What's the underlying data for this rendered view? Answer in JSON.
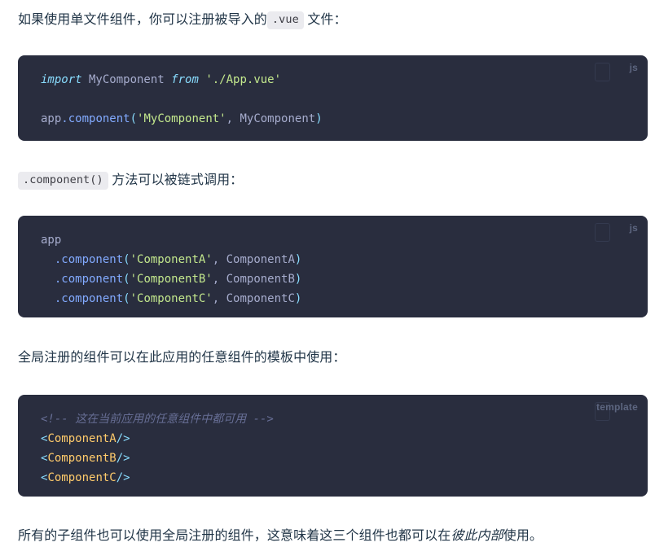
{
  "page": {
    "background": "#ffffff",
    "text_color": "#213547",
    "code_bg": "#292d3e",
    "inline_code_bg": "#ebebef",
    "accent_string": "#c3e88d",
    "accent_keyword": "#89ddff",
    "accent_function": "#82aaff",
    "accent_tag": "#ffcb6b",
    "accent_comment": "#676e95",
    "lang_label_color": "#5d6680"
  },
  "paragraphs": {
    "p1": {
      "before": "如果使用单文件组件，你可以注册被导入的",
      "code": ".vue",
      "after": "文件："
    },
    "p2": {
      "code": ".component()",
      "after": "方法可以被链式调用："
    },
    "p3": {
      "text": "全局注册的组件可以在此应用的任意组件的模板中使用："
    },
    "p4": {
      "before": "所有的子组件也可以使用全局注册的组件，这意味着这三个组件也都可以在",
      "emphasis": "彼此内部",
      "after": "使用。"
    }
  },
  "code_blocks": [
    {
      "lang_label": "js",
      "copy_label": "copy-code",
      "lines": [
        {
          "tokens": [
            {
              "text": "import",
              "type": "keyword"
            },
            {
              "text": " MyComponent ",
              "type": "variable"
            },
            {
              "text": "from",
              "type": "keyword"
            },
            {
              "text": " ",
              "type": "variable"
            },
            {
              "text": "'./App.vue'",
              "type": "string"
            }
          ]
        },
        {
          "tokens": []
        },
        {
          "tokens": [
            {
              "text": "app",
              "type": "variable"
            },
            {
              "text": ".component",
              "type": "function"
            },
            {
              "text": "(",
              "type": "punct"
            },
            {
              "text": "'MyComponent'",
              "type": "string"
            },
            {
              "text": ", ",
              "type": "variable"
            },
            {
              "text": "MyComponent",
              "type": "variable"
            },
            {
              "text": ")",
              "type": "punct"
            }
          ]
        }
      ]
    },
    {
      "lang_label": "js",
      "copy_label": "copy-code",
      "lines": [
        {
          "tokens": [
            {
              "text": "app",
              "type": "variable"
            }
          ]
        },
        {
          "tokens": [
            {
              "text": "  ",
              "type": "variable"
            },
            {
              "text": ".component",
              "type": "function"
            },
            {
              "text": "(",
              "type": "punct"
            },
            {
              "text": "'ComponentA'",
              "type": "string"
            },
            {
              "text": ", ",
              "type": "variable"
            },
            {
              "text": "ComponentA",
              "type": "variable"
            },
            {
              "text": ")",
              "type": "punct"
            }
          ]
        },
        {
          "tokens": [
            {
              "text": "  ",
              "type": "variable"
            },
            {
              "text": ".component",
              "type": "function"
            },
            {
              "text": "(",
              "type": "punct"
            },
            {
              "text": "'ComponentB'",
              "type": "string"
            },
            {
              "text": ", ",
              "type": "variable"
            },
            {
              "text": "ComponentB",
              "type": "variable"
            },
            {
              "text": ")",
              "type": "punct"
            }
          ]
        },
        {
          "tokens": [
            {
              "text": "  ",
              "type": "variable"
            },
            {
              "text": ".component",
              "type": "function"
            },
            {
              "text": "(",
              "type": "punct"
            },
            {
              "text": "'ComponentC'",
              "type": "string"
            },
            {
              "text": ", ",
              "type": "variable"
            },
            {
              "text": "ComponentC",
              "type": "variable"
            },
            {
              "text": ")",
              "type": "punct"
            }
          ]
        }
      ]
    },
    {
      "lang_label": "template",
      "copy_label": "copy-code",
      "lines": [
        {
          "tokens": [
            {
              "text": "<!-- 这在当前应用的任意组件中都可用 -->",
              "type": "comment"
            }
          ]
        },
        {
          "tokens": [
            {
              "text": "<",
              "type": "bracket"
            },
            {
              "text": "ComponentA",
              "type": "tag"
            },
            {
              "text": "/>",
              "type": "bracket"
            }
          ]
        },
        {
          "tokens": [
            {
              "text": "<",
              "type": "bracket"
            },
            {
              "text": "ComponentB",
              "type": "tag"
            },
            {
              "text": "/>",
              "type": "bracket"
            }
          ]
        },
        {
          "tokens": [
            {
              "text": "<",
              "type": "bracket"
            },
            {
              "text": "ComponentC",
              "type": "tag"
            },
            {
              "text": "/>",
              "type": "bracket"
            }
          ]
        }
      ]
    }
  ]
}
